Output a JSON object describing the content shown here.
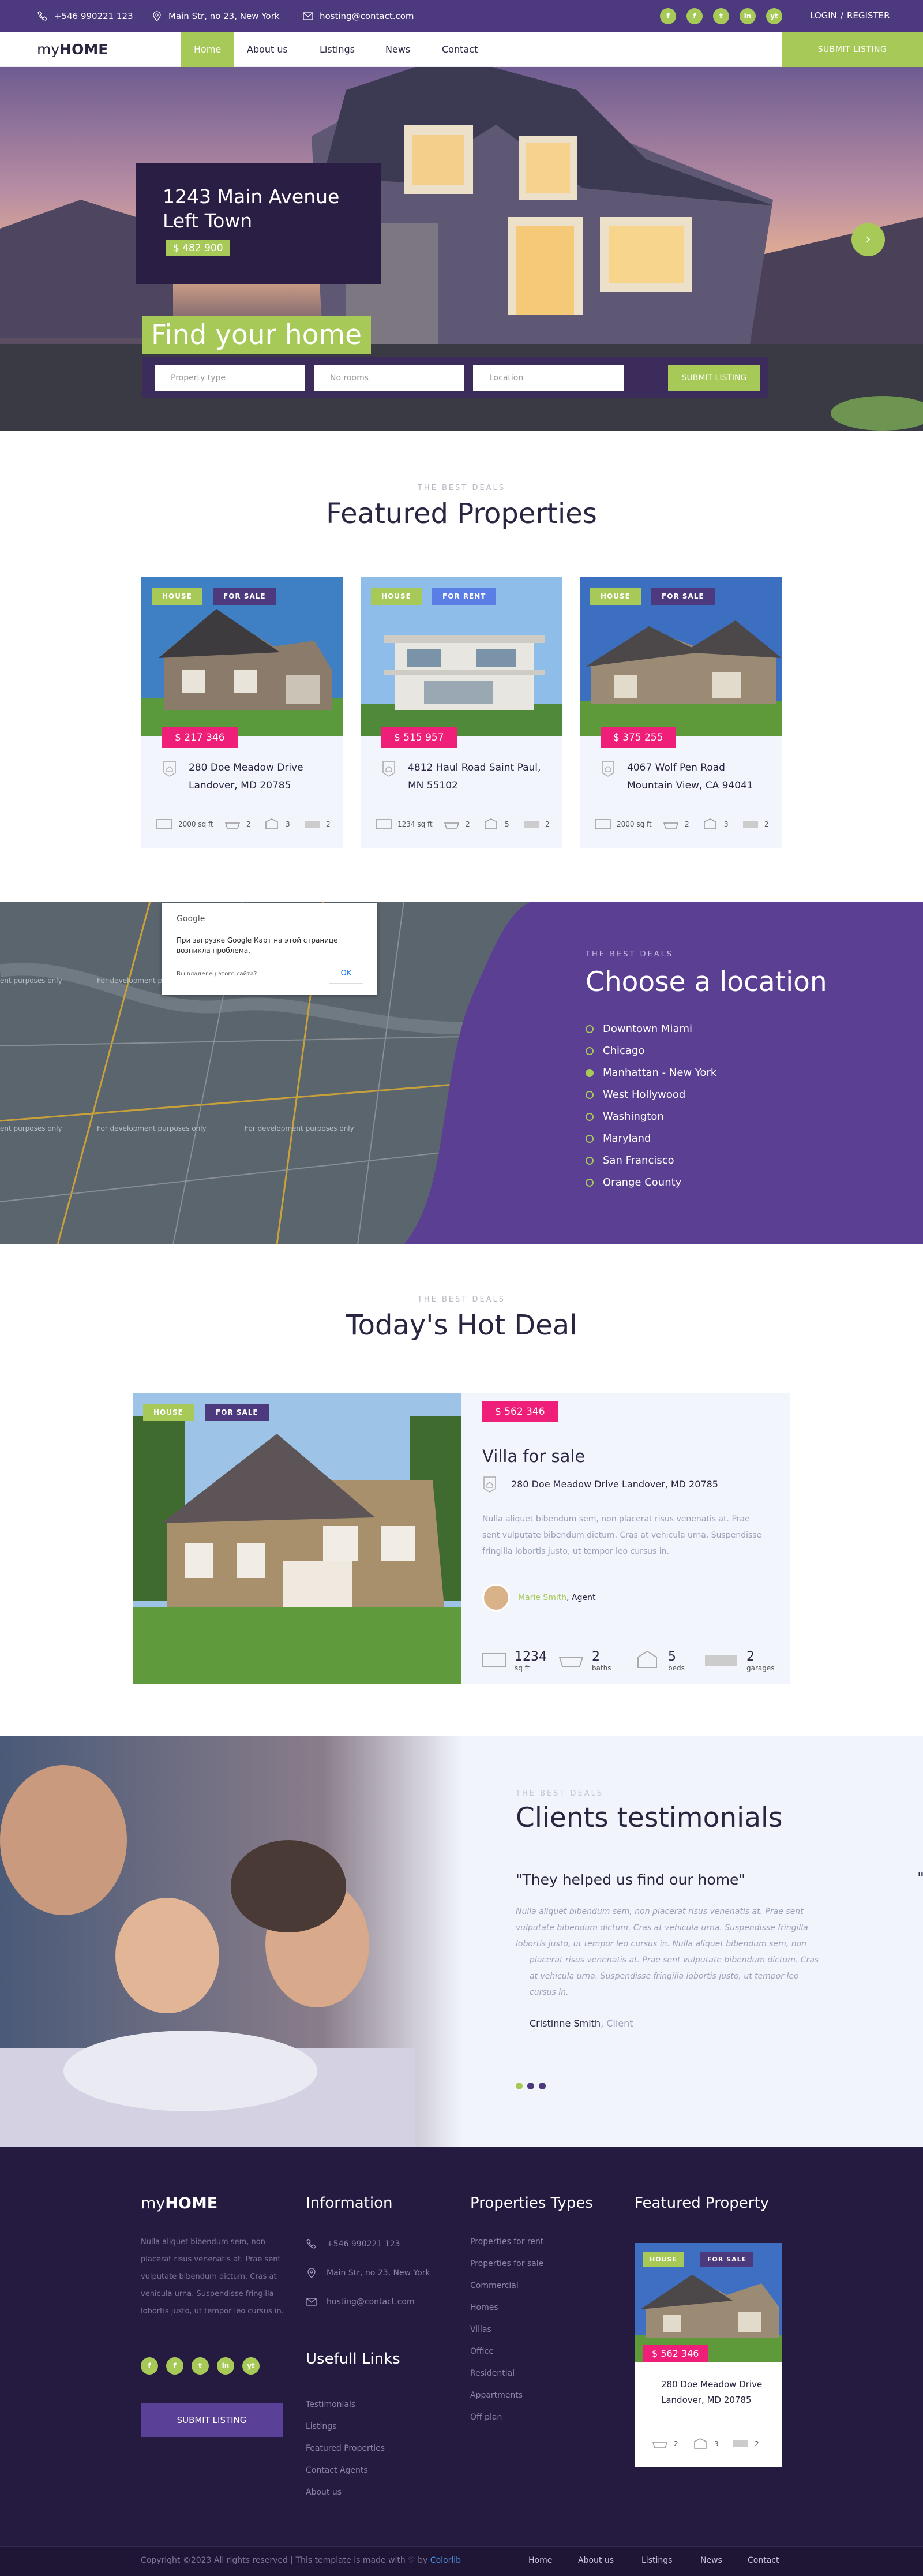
{
  "topbar": {
    "phone": "+546 990221 123",
    "address": "Main Str, no 23, New York",
    "email": "hosting@contact.com",
    "social": [
      "f",
      "f",
      "t",
      "in",
      "yt"
    ],
    "login": "LOGIN",
    "separator": "/",
    "register": "REGISTER"
  },
  "nav": {
    "logo_prefix": "my",
    "logo_bold": "HOME",
    "items": [
      "Home",
      "About us",
      "Listings",
      "News",
      "Contact"
    ],
    "submit": "SUBMIT LISTING"
  },
  "hero": {
    "address_line1": "1243 Main Avenue",
    "address_line2": "Left Town",
    "price": "$ 482 900",
    "next_icon": "›",
    "headline": "Find your home",
    "search": {
      "property_type": "Property type",
      "rooms": "No rooms",
      "location": "Location",
      "submit": "SUBMIT LISTING"
    }
  },
  "featured": {
    "kicker": "THE BEST DEALS",
    "title": "Featured Properties",
    "cards": [
      {
        "tag1": "HOUSE",
        "tag2": "FOR SALE",
        "price": "$ 217 346",
        "addr1": "280 Doe Meadow Drive",
        "addr2": "Landover, MD 20785",
        "area": "2000 sq ft",
        "baths": "2",
        "beds": "3",
        "garages": "2"
      },
      {
        "tag1": "HOUSE",
        "tag2": "FOR RENT",
        "price": "$ 515 957",
        "addr1": "4812 Haul Road Saint Paul,",
        "addr2": "MN 55102",
        "area": "1234 sq ft",
        "baths": "2",
        "beds": "5",
        "garages": "2"
      },
      {
        "tag1": "HOUSE",
        "tag2": "FOR SALE",
        "price": "$ 375 255",
        "addr1": "4067 Wolf Pen Road",
        "addr2": "Mountain View, CA 94041",
        "area": "2000 sq ft",
        "baths": "2",
        "beds": "3",
        "garages": "2"
      }
    ]
  },
  "location": {
    "map_notice_brand": "Google",
    "map_notice_text": "При загрузке Google Карт на этой странице возникла проблема.",
    "map_notice_question": "Вы владелец этого сайта?",
    "map_notice_ok": "OK",
    "map_watermark": "For development purposes only",
    "map_watermark_short": "ent purposes only",
    "kicker": "THE BEST DEALS",
    "title": "Choose a location",
    "items": [
      "Downtown Miami",
      "Chicago",
      "Manhattan - New York",
      "West Hollywood",
      "Washington",
      "Maryland",
      "San Francisco",
      "Orange County"
    ],
    "active_index": 2
  },
  "hotdeal": {
    "kicker": "THE BEST DEALS",
    "title": "Today's Hot Deal",
    "tag1": "HOUSE",
    "tag2": "FOR SALE",
    "price": "$ 562 346",
    "name": "Villa for sale",
    "address": "280 Doe Meadow Drive Landover, MD 20785",
    "description": "Nulla aliquet bibendum sem, non placerat risus venenatis at. Prae sent vulputate bibendum dictum. Cras at vehicula urna. Suspendisse fringilla lobortis justo, ut tempor leo cursus in.",
    "agent_name": "Marie Smith",
    "agent_role": ", Agent",
    "stats": [
      {
        "value": "1234",
        "unit": "sq ft"
      },
      {
        "value": "2",
        "unit": "baths"
      },
      {
        "value": "5",
        "unit": "beds"
      },
      {
        "value": "2",
        "unit": "garages"
      }
    ]
  },
  "testimonials": {
    "kicker": "THE BEST DEALS",
    "title": "Clients testimonials",
    "quote": "\"They helped us find our home\"",
    "text1": "Nulla aliquet bibendum sem, non placerat risus venenatis at. Prae sent vulputate bibendum dictum. Cras at vehicula urna. Suspendisse fringilla lobortis justo, ut tempor leo cursus in. Nulla aliquet bibendum sem, non",
    "text2": "placerat risus venenatis at. Prae sent vulputate bibendum dictum. Cras at vehicula urna. Suspendisse fringilla lobortis justo, ut tempor leo cursus in.",
    "author": "Cristinne Smith",
    "role": ", Client",
    "next_quote_mark": "\""
  },
  "footer": {
    "logo_prefix": "my",
    "logo_bold": "HOME",
    "description": "Nulla aliquet bibendum sem, non placerat risus venenatis at. Prae sent vulputate bibendum dictum. Cras at vehicula urna. Suspendisse fringilla lobortis justo, ut tempor leo cursus in.",
    "social": [
      "f",
      "f",
      "t",
      "in",
      "yt"
    ],
    "submit": "SUBMIT LISTING",
    "info_title": "Information",
    "phone": "+546 990221 123",
    "address": "Main Str, no 23, New York",
    "email": "hosting@contact.com",
    "useful_title": "Usefull Links",
    "useful_links": [
      "Testimonials",
      "Listings",
      "Featured Properties",
      "Contact Agents",
      "About us"
    ],
    "types_title": "Properties Types",
    "types": [
      "Properties for rent",
      "Properties for sale",
      "Commercial",
      "Homes",
      "Villas",
      "Office",
      "Residential",
      "Appartments",
      "Off plan"
    ],
    "featured_title": "Featured Property",
    "featured": {
      "tag1": "HOUSE",
      "tag2": "FOR SALE",
      "price": "$ 562 346",
      "addr1": "280 Doe Meadow Drive",
      "addr2": "Landover, MD 20785",
      "baths": "2",
      "beds": "3",
      "garages": "2"
    },
    "copyright_prefix": "Copyright ©2023 All rights reserved | This template is made with ♡ by ",
    "copyright_link": "Colorlib",
    "bottom_links": [
      "Home",
      "About us",
      "Listings",
      "News",
      "Contact"
    ]
  },
  "colors": {
    "purple": "#4d3a7e",
    "green": "#a7c957",
    "pink": "#ee1e79",
    "dark": "#251a3f"
  }
}
